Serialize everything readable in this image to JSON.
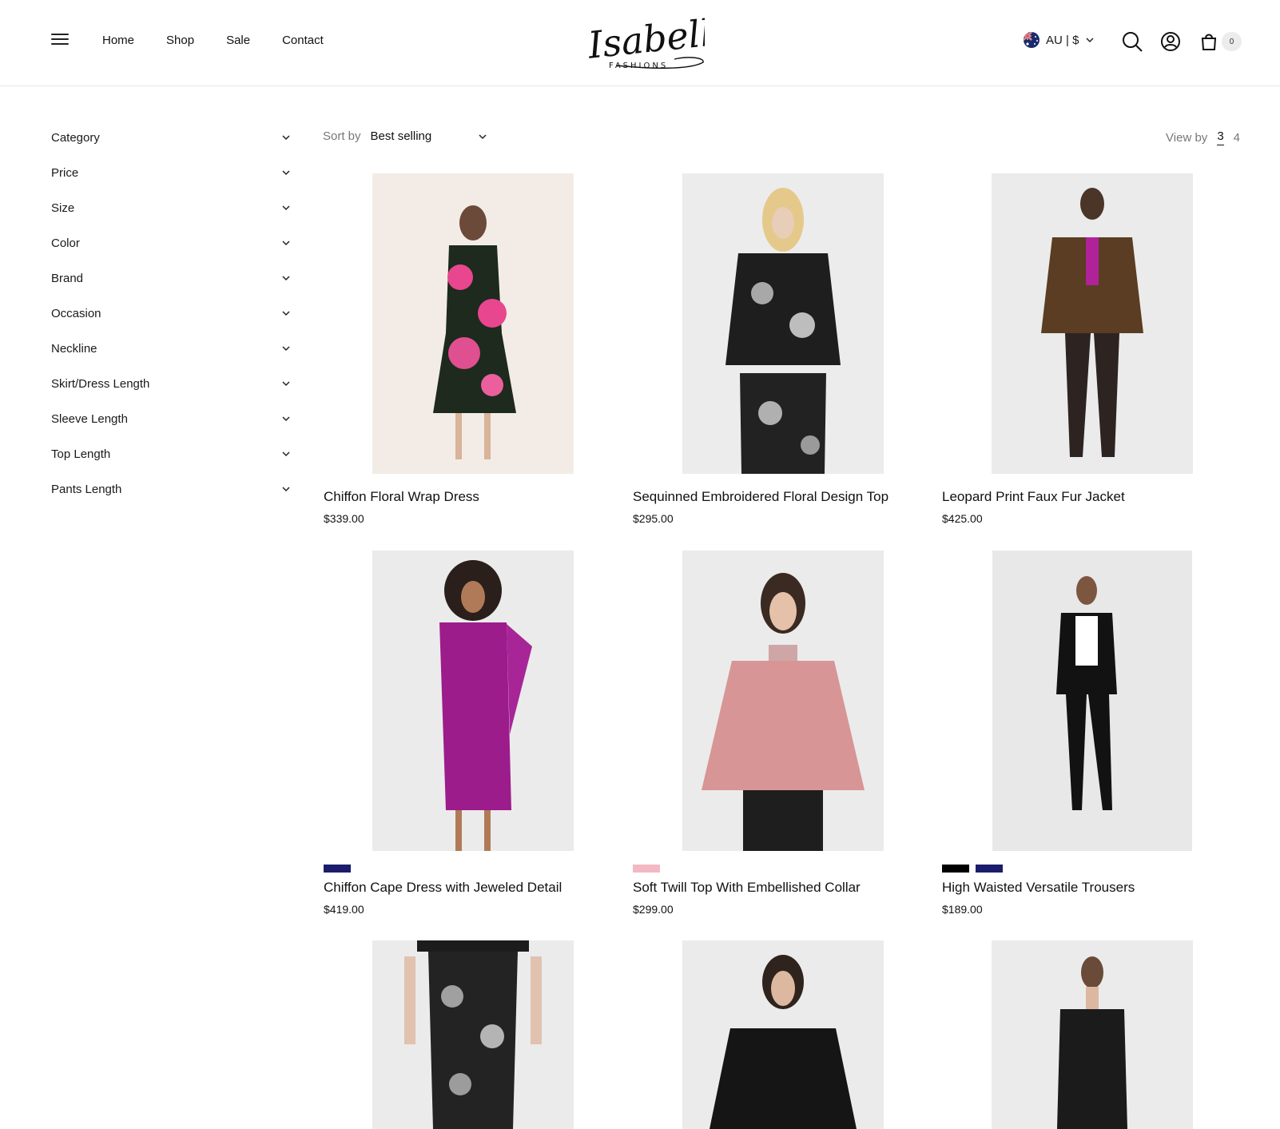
{
  "header": {
    "nav": [
      "Home",
      "Shop",
      "Sale",
      "Contact"
    ],
    "brand_script": "Isabella",
    "brand_sub": "FASHIONS",
    "locale": "AU | $",
    "cart_count": "0"
  },
  "filters": [
    "Category",
    "Price",
    "Size",
    "Color",
    "Brand",
    "Occasion",
    "Neckline",
    "Skirt/Dress Length",
    "Sleeve Length",
    "Top Length",
    "Pants Length"
  ],
  "toolbar": {
    "sort_label": "Sort by",
    "sort_value": "Best selling",
    "view_label": "View by",
    "view_options": [
      "3",
      "4"
    ],
    "view_selected": "3"
  },
  "products": [
    {
      "name": "Chiffon Floral Wrap Dress",
      "price": "$339.00",
      "swatches": []
    },
    {
      "name": "Sequinned Embroidered Floral Design Top",
      "price": "$295.00",
      "swatches": []
    },
    {
      "name": "Leopard Print Faux Fur Jacket",
      "price": "$425.00",
      "swatches": []
    },
    {
      "name": "Chiffon Cape Dress with Jeweled Detail",
      "price": "$419.00",
      "swatches": [
        "#1b1c6b"
      ]
    },
    {
      "name": "Soft Twill Top With Embellished Collar",
      "price": "$299.00",
      "swatches": [
        "#f2b9c5"
      ]
    },
    {
      "name": "High Waisted Versatile Trousers",
      "price": "$189.00",
      "swatches": [
        "#000000",
        "#1b1c6b"
      ]
    },
    {
      "name": "",
      "price": "",
      "swatches": []
    },
    {
      "name": "",
      "price": "",
      "swatches": []
    },
    {
      "name": "",
      "price": "",
      "swatches": []
    }
  ],
  "colors": {
    "text": "#111111",
    "muted": "#777777",
    "border": "#e6e6e6",
    "photo_bg": "#ebebeb"
  }
}
